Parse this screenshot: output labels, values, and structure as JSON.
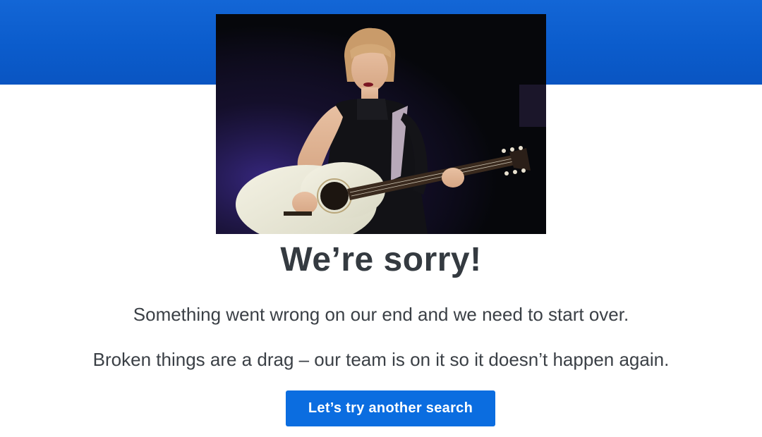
{
  "banner": {
    "color": "#0b5ccc"
  },
  "hero_image": {
    "subject": "performer-with-acoustic-guitar"
  },
  "content": {
    "headline": "We’re sorry!",
    "message_1": "Something went wrong on our end and we need to start over.",
    "message_2": "Broken things are a drag – our team is on it so it doesn’t happen again."
  },
  "actions": {
    "retry_label": "Let’s try another search",
    "button_color": "#0b6de0"
  }
}
